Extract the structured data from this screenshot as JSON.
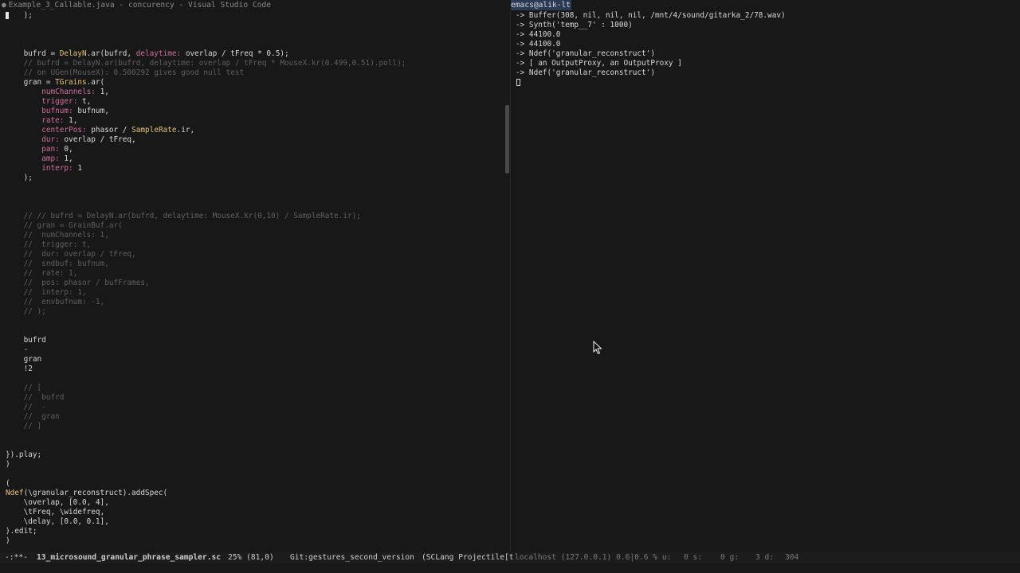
{
  "window": {
    "left_title": "Example_3_Callable.java - concurency - Visual Studio Code",
    "right_title": "emacs@alik-lt"
  },
  "colors": {
    "background": "#181818",
    "default": "#d8d8d8",
    "comment": "#5f5f5f",
    "class": "#e5c07b",
    "key": "#d16d9e",
    "symbol": "#a5b85c",
    "tab_bg": "#2b3a55"
  },
  "editor": {
    "lines": [
      {
        "row": 0,
        "indent": 2,
        "tokens": [
          {
            "t": ");",
            "c": "default"
          }
        ]
      },
      {
        "row": 4,
        "indent": 2,
        "tokens": [
          {
            "t": "bufrd = ",
            "c": "default"
          },
          {
            "t": "DelayN",
            "c": "class"
          },
          {
            "t": ".ar(bufrd, ",
            "c": "default"
          },
          {
            "t": "delaytime:",
            "c": "key"
          },
          {
            "t": " overlap / tFreq * 0.5);",
            "c": "default"
          }
        ]
      },
      {
        "row": 5,
        "indent": 2,
        "tokens": [
          {
            "t": "// bufrd = DelayN.ar(bufrd, delaytime: overlap / tFreq * MouseX.kr(0.499,0.51).poll);",
            "c": "comment"
          }
        ]
      },
      {
        "row": 6,
        "indent": 2,
        "tokens": [
          {
            "t": "// on UGen(MouseX): 0.500292 gives good null test",
            "c": "comment"
          }
        ]
      },
      {
        "row": 7,
        "indent": 2,
        "tokens": [
          {
            "t": "gran = ",
            "c": "default"
          },
          {
            "t": "TGrains",
            "c": "class"
          },
          {
            "t": ".ar(",
            "c": "default"
          }
        ]
      },
      {
        "row": 8,
        "indent": 4,
        "tokens": [
          {
            "t": "numChannels:",
            "c": "key"
          },
          {
            "t": " 1,",
            "c": "default"
          }
        ]
      },
      {
        "row": 9,
        "indent": 4,
        "tokens": [
          {
            "t": "trigger:",
            "c": "key"
          },
          {
            "t": " t,",
            "c": "default"
          }
        ]
      },
      {
        "row": 10,
        "indent": 4,
        "tokens": [
          {
            "t": "bufnum:",
            "c": "key"
          },
          {
            "t": " bufnum,",
            "c": "default"
          }
        ]
      },
      {
        "row": 11,
        "indent": 4,
        "tokens": [
          {
            "t": "rate:",
            "c": "key"
          },
          {
            "t": " 1,",
            "c": "default"
          }
        ]
      },
      {
        "row": 12,
        "indent": 4,
        "tokens": [
          {
            "t": "centerPos:",
            "c": "key"
          },
          {
            "t": " phasor / ",
            "c": "default"
          },
          {
            "t": "SampleRate",
            "c": "class"
          },
          {
            "t": ".ir,",
            "c": "default"
          }
        ]
      },
      {
        "row": 13,
        "indent": 4,
        "tokens": [
          {
            "t": "dur:",
            "c": "key"
          },
          {
            "t": " overlap / tFreq,",
            "c": "default"
          }
        ]
      },
      {
        "row": 14,
        "indent": 4,
        "tokens": [
          {
            "t": "pan:",
            "c": "key"
          },
          {
            "t": " 0,",
            "c": "default"
          }
        ]
      },
      {
        "row": 15,
        "indent": 4,
        "tokens": [
          {
            "t": "amp:",
            "c": "key"
          },
          {
            "t": " 1,",
            "c": "default"
          }
        ]
      },
      {
        "row": 16,
        "indent": 4,
        "tokens": [
          {
            "t": "interp:",
            "c": "key"
          },
          {
            "t": " 1",
            "c": "default"
          }
        ]
      },
      {
        "row": 17,
        "indent": 2,
        "tokens": [
          {
            "t": ");",
            "c": "default"
          }
        ]
      },
      {
        "row": 21,
        "indent": 2,
        "tokens": [
          {
            "t": "// // bufrd = DelayN.ar(bufrd, delaytime: MouseX.kr(0,10) / SampleRate.ir);",
            "c": "comment"
          }
        ]
      },
      {
        "row": 22,
        "indent": 2,
        "tokens": [
          {
            "t": "// gran = GrainBuf.ar(",
            "c": "comment"
          }
        ]
      },
      {
        "row": 23,
        "indent": 2,
        "tokens": [
          {
            "t": "//  numChannels: 1,",
            "c": "comment"
          }
        ]
      },
      {
        "row": 24,
        "indent": 2,
        "tokens": [
          {
            "t": "//  trigger: t,",
            "c": "comment"
          }
        ]
      },
      {
        "row": 25,
        "indent": 2,
        "tokens": [
          {
            "t": "//  dur: overlap / tFreq,",
            "c": "comment"
          }
        ]
      },
      {
        "row": 26,
        "indent": 2,
        "tokens": [
          {
            "t": "//  sndbuf: bufnum,",
            "c": "comment"
          }
        ]
      },
      {
        "row": 27,
        "indent": 2,
        "tokens": [
          {
            "t": "//  rate: 1,",
            "c": "comment"
          }
        ]
      },
      {
        "row": 28,
        "indent": 2,
        "tokens": [
          {
            "t": "//  pos: phasor / bufFrames,",
            "c": "comment"
          }
        ]
      },
      {
        "row": 29,
        "indent": 2,
        "tokens": [
          {
            "t": "//  interp: 1,",
            "c": "comment"
          }
        ]
      },
      {
        "row": 30,
        "indent": 2,
        "tokens": [
          {
            "t": "//  envbufnum: -1,",
            "c": "comment"
          }
        ]
      },
      {
        "row": 31,
        "indent": 2,
        "tokens": [
          {
            "t": "// );",
            "c": "comment"
          }
        ]
      },
      {
        "row": 34,
        "indent": 2,
        "tokens": [
          {
            "t": "bufrd",
            "c": "default"
          }
        ]
      },
      {
        "row": 35,
        "indent": 2,
        "tokens": [
          {
            "t": "-",
            "c": "default"
          }
        ]
      },
      {
        "row": 36,
        "indent": 2,
        "tokens": [
          {
            "t": "gran",
            "c": "default"
          }
        ]
      },
      {
        "row": 37,
        "indent": 2,
        "tokens": [
          {
            "t": "!2",
            "c": "default"
          }
        ]
      },
      {
        "row": 39,
        "indent": 2,
        "tokens": [
          {
            "t": "// [",
            "c": "comment"
          }
        ]
      },
      {
        "row": 40,
        "indent": 2,
        "tokens": [
          {
            "t": "//  bufrd",
            "c": "comment"
          }
        ]
      },
      {
        "row": 41,
        "indent": 2,
        "tokens": [
          {
            "t": "//  -",
            "c": "comment"
          }
        ]
      },
      {
        "row": 42,
        "indent": 2,
        "tokens": [
          {
            "t": "//  gran",
            "c": "comment"
          }
        ]
      },
      {
        "row": 43,
        "indent": 2,
        "tokens": [
          {
            "t": "// ]",
            "c": "comment"
          }
        ]
      },
      {
        "row": 46,
        "indent": 0,
        "tokens": [
          {
            "t": "}).play;",
            "c": "default"
          }
        ]
      },
      {
        "row": 47,
        "indent": 0,
        "tokens": [
          {
            "t": ")",
            "c": "default"
          }
        ]
      },
      {
        "row": 49,
        "indent": 0,
        "tokens": [
          {
            "t": "(",
            "c": "default"
          }
        ]
      },
      {
        "row": 50,
        "indent": 0,
        "tokens": [
          {
            "t": "Ndef",
            "c": "class"
          },
          {
            "t": "(\\granular_reconstruct).addSpec(",
            "c": "default"
          }
        ]
      },
      {
        "row": 51,
        "indent": 2,
        "tokens": [
          {
            "t": "\\overlap",
            "c": "symbol"
          },
          {
            "t": ", [0.0, 4],",
            "c": "default"
          }
        ]
      },
      {
        "row": 52,
        "indent": 2,
        "tokens": [
          {
            "t": "\\tFreq",
            "c": "symbol"
          },
          {
            "t": ", ",
            "c": "default"
          },
          {
            "t": "\\widefreq",
            "c": "symbol"
          },
          {
            "t": ",",
            "c": "default"
          }
        ]
      },
      {
        "row": 53,
        "indent": 2,
        "tokens": [
          {
            "t": "\\delay",
            "c": "symbol"
          },
          {
            "t": ", [0.0, 0.1],",
            "c": "default"
          }
        ]
      },
      {
        "row": 54,
        "indent": 0,
        "tokens": [
          {
            "t": ").edit;",
            "c": "default"
          }
        ]
      },
      {
        "row": 55,
        "indent": 0,
        "tokens": [
          {
            "t": ")",
            "c": "default"
          }
        ]
      }
    ]
  },
  "repl": {
    "lines": [
      "-> Buffer(308, nil, nil, nil, /mnt/4/sound/gitarka_2/78.wav)",
      "-> Synth('temp__7' : 1000)",
      "-> 44100.0",
      "-> 44100.0",
      "-> Ndef('granular_reconstruct')",
      "-> [ an OutputProxy, an OutputProxy ]",
      "-> Ndef('granular_reconstruct')"
    ]
  },
  "modeline": {
    "state": "-:**-",
    "buffer": "13_microsound_granular_phrase_sampler.sc",
    "position": "25% (81,0)",
    "vc": "Git:gestures_second_version",
    "mode": "(SCLang Projectile[t",
    "server": "localhost (127.0.0.1) 0.6|0.6 % u:",
    "s": "0 s:",
    "g": "0 g:",
    "d": "3 d:",
    "num": "304"
  }
}
